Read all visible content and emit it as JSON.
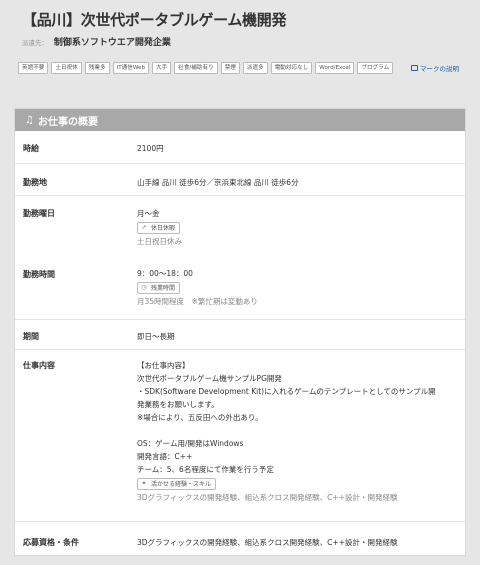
{
  "header": {
    "title": "【品川】次世代ポータブルゲーム機開発",
    "company_label": "派遣先：",
    "company_name": "制御系ソフトウエア開発企業"
  },
  "tags": [
    "英語不要",
    "土日祝休",
    "残業多",
    "IT通信Web",
    "大手",
    "社食/補助有り",
    "禁煙",
    "派遣多",
    "電動対応なし",
    "Word/Excel",
    "プログラム"
  ],
  "mark_link": "マークの説明",
  "panel": {
    "title": "お仕事の概要",
    "rows": {
      "wage": {
        "label": "時給",
        "value": "2100円"
      },
      "location": {
        "label": "勤務地",
        "value": "山手線 品川 徒歩6分／京浜東北線 品川 徒歩6分"
      },
      "days": {
        "label": "勤務曜日",
        "value": "月〜金",
        "pill": "休日休暇",
        "note": "土日祝日休み"
      },
      "hours": {
        "label": "勤務時間",
        "value": "9：00〜18：00",
        "pill": "残業時間",
        "note": "月35時間程度　※繁忙期は変動あり"
      },
      "period": {
        "label": "期間",
        "value": "即日〜長期"
      },
      "content": {
        "label": "仕事内容",
        "lines": [
          "【お仕事内容】",
          "次世代ポータブルゲーム機サンプルPG開発",
          "・SDK(Software Development Kit)に入れるゲームのテンプレートとしてのサンプル開",
          "発業務をお願いします。",
          "※場合により、五反田への外出あり。",
          "",
          "OS：ゲーム用/開発はWindows",
          "開発言語：C++",
          "チーム：5、6名程度にて作業を行う予定"
        ],
        "pill": "活かせる経験・スキル",
        "note": "3Dグラフィックスの開発経験、組込系クロス開発経験、C++設計・開発経験"
      },
      "requirements": {
        "label": "応募資格・条件",
        "value": "3Dグラフィックスの開発経験、組込系クロス開発経験、C++設計・開発経験"
      }
    }
  }
}
